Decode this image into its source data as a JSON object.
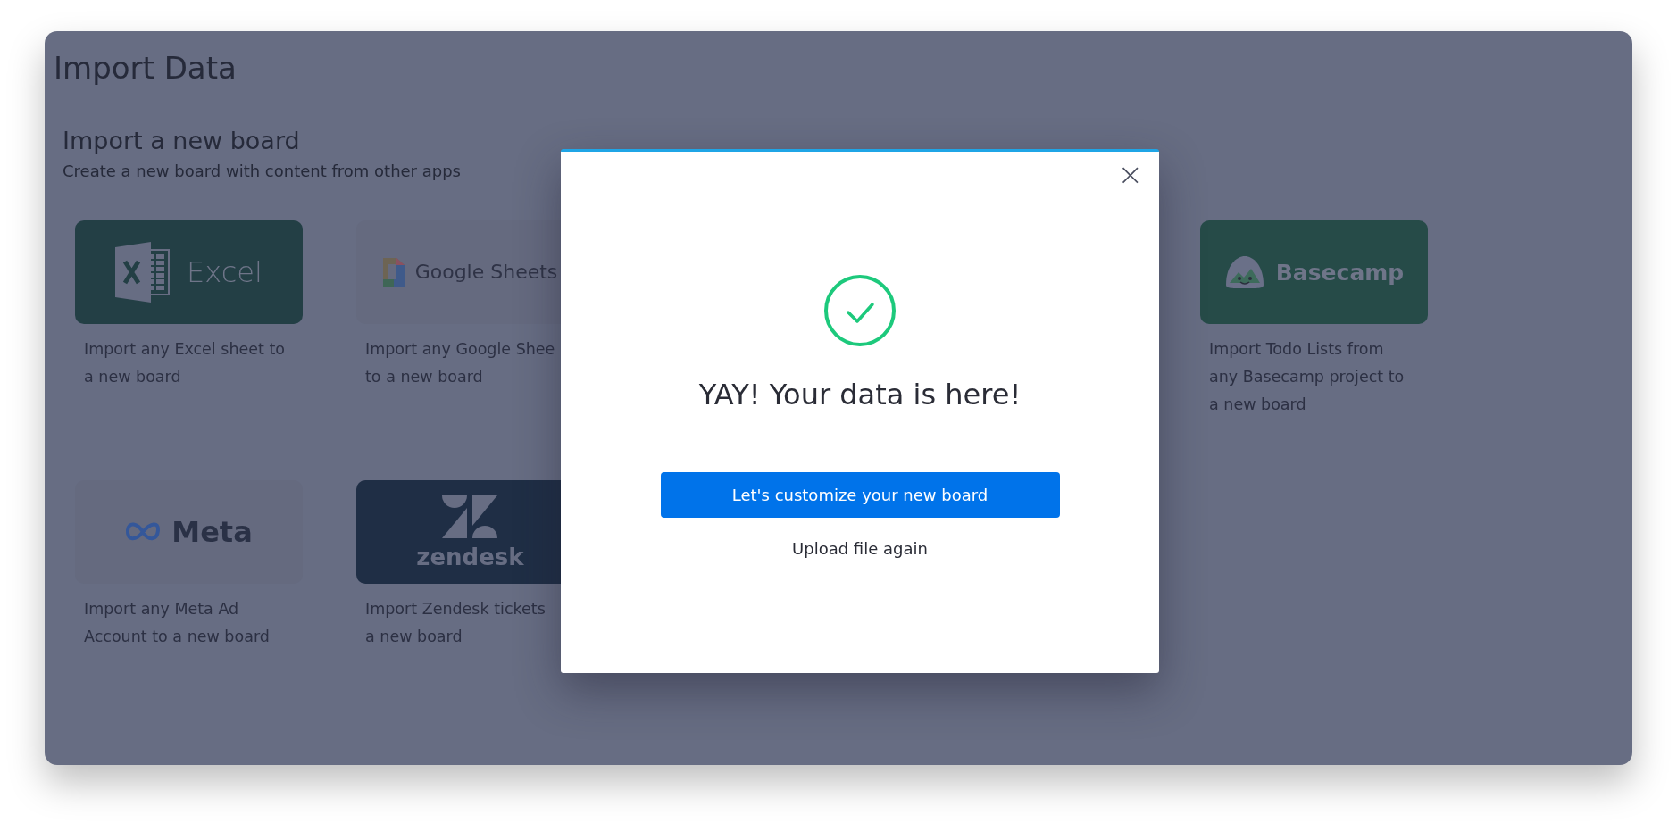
{
  "page": {
    "title": "Import Data"
  },
  "section": {
    "heading": "Import a new board",
    "subheading": "Create a new board with content from other apps"
  },
  "rows": [
    {
      "cards": [
        {
          "kind": "excel",
          "logo_text": "Excel",
          "color": "#233f45",
          "description": [
            "Import any Excel sheet to",
            "a new board"
          ]
        },
        {
          "kind": "sheets",
          "logo_text": "Google Sheets",
          "color": "#656a7f",
          "description": [
            "Import any Google Shee",
            "to a new board"
          ]
        },
        {
          "kind": "basecamp",
          "logo_text": "Basecamp",
          "color": "#264b48",
          "description": [
            "Import Todo Lists from",
            "any Basecamp project to",
            "a new board"
          ]
        }
      ]
    },
    {
      "cards": [
        {
          "kind": "meta",
          "logo_text": "Meta",
          "color": "#656a7f",
          "description": [
            "Import any Meta Ad",
            "Account to a new board"
          ]
        },
        {
          "kind": "zendesk",
          "logo_text": "zendesk",
          "color": "#1f2e45",
          "description": [
            "Import Zendesk tickets",
            "a new board"
          ]
        }
      ]
    }
  ],
  "dialog": {
    "close": "×",
    "heading": "YAY! Your data is here!",
    "primary_button": "Let's customize your new board",
    "secondary_link": "Upload file again"
  }
}
